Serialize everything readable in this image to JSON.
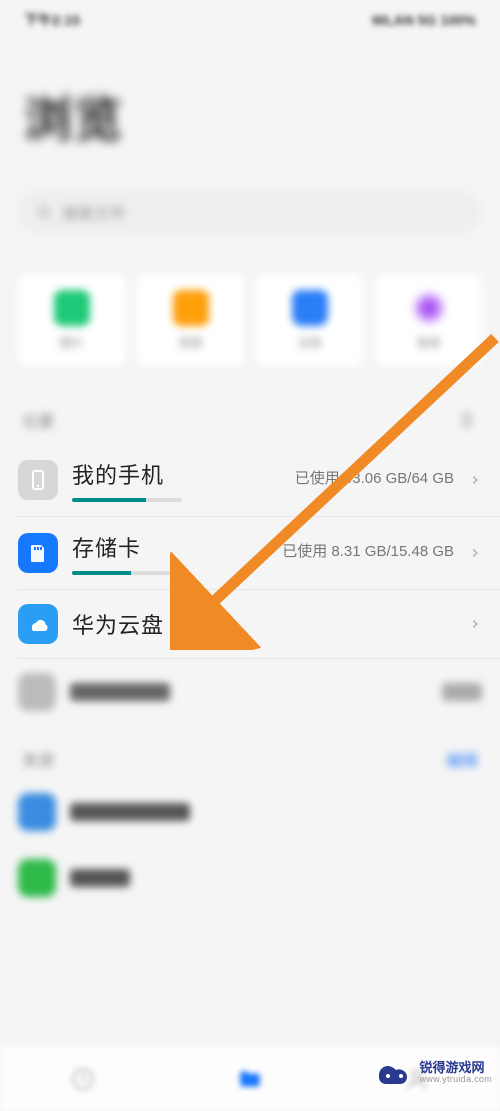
{
  "status": {
    "left": "下午2:15",
    "right": "WLAN 5G 100%"
  },
  "header": {
    "title": "浏览"
  },
  "search": {
    "placeholder": "搜索文件"
  },
  "categories": [
    {
      "label": "图片",
      "icon": "image-icon",
      "color": "green"
    },
    {
      "label": "视频",
      "icon": "video-icon",
      "color": "orange"
    },
    {
      "label": "文档",
      "icon": "document-icon",
      "color": "blue"
    },
    {
      "label": "音频",
      "icon": "audio-icon",
      "color": "purple"
    }
  ],
  "section_storage": {
    "title": "位置",
    "items": [
      {
        "name": "我的手机",
        "usage_prefix": "已使用",
        "used": "43.06 GB",
        "total": "64 GB",
        "usage_text": "已使用 43.06 GB/64 GB",
        "progress_pct": 67
      },
      {
        "name": "存储卡",
        "usage_prefix": "已使用",
        "used": "8.31 GB",
        "total": "15.48 GB",
        "usage_text": "已使用 8.31 GB/15.48 GB",
        "progress_pct": 54
      },
      {
        "name": "华为云盘",
        "usage_text": ""
      }
    ]
  },
  "section_recent": {
    "title_left": "来源",
    "title_right": "编辑"
  },
  "watermark": {
    "title": "锐得游戏网",
    "subtitle": "www.ytruida.com"
  },
  "colors": {
    "accent_blue": "#1677ff",
    "arrow": "#f08a24",
    "progress": "#008b8b"
  }
}
